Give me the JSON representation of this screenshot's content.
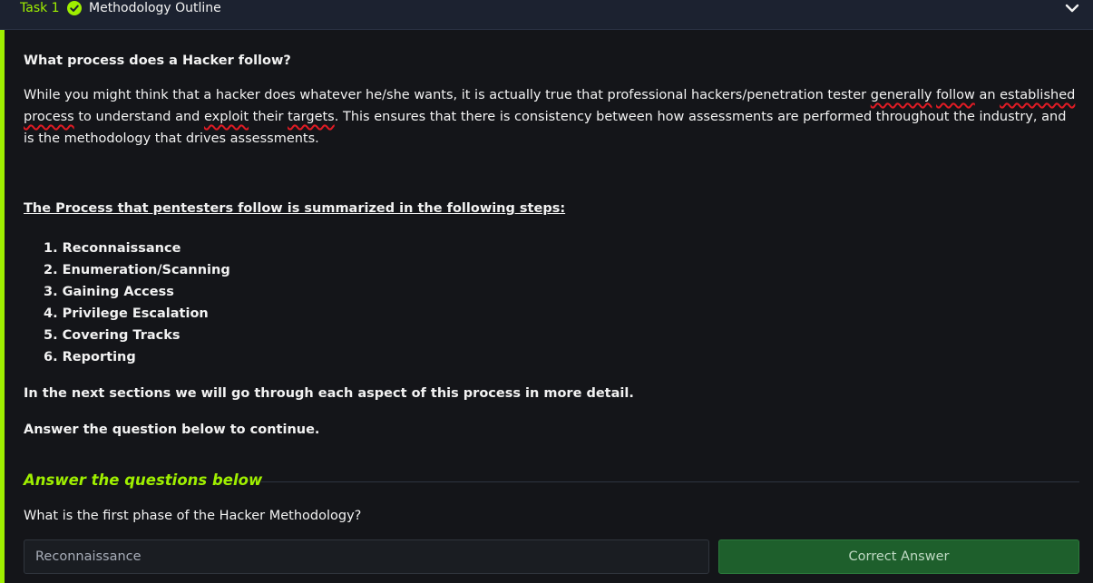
{
  "header": {
    "task_label": "Task 1",
    "title": "Methodology Outline",
    "status_icon": "check-circle-icon",
    "toggle_icon": "chevron-down-icon"
  },
  "colors": {
    "accent": "#9fef00",
    "background": "#141519",
    "header_bg": "#1c2230",
    "success_button": "#1e5f2c",
    "spellcheck": "#e01b24"
  },
  "content": {
    "question_heading": "What process does a Hacker follow?",
    "paragraph": {
      "p1": "While you might think that a hacker does whatever he/she wants, it is actually true that professional hackers/penetration tester ",
      "w1": "generally",
      "s1": " ",
      "w2": "follow",
      "s2": " an ",
      "w3": "established",
      "s3": " ",
      "w4": "process",
      "s4": " to understand and ",
      "w5": "exploit",
      "s5": " their ",
      "w6": "targets",
      "p2": ". This ensures that there is consistency between how assessments are performed throughout the industry, and is the methodology that drives assessments."
    },
    "steps_title": "The Process that pentesters follow is summarized in the following steps:",
    "steps": [
      "1. Reconnaissance",
      "2. Enumeration/Scanning",
      "3. Gaining Access",
      "4. Privilege Escalation",
      "5. Covering Tracks",
      "6. Reporting"
    ],
    "next_sections": "In the next sections we will go through each aspect of this process in more detail.",
    "continue_text": "Answer the question below to continue."
  },
  "answers": {
    "heading": "Answer the questions below",
    "question": "What is the first phase of the Hacker Methodology?",
    "input_value": "Reconnaissance",
    "button_label": "Correct Answer"
  }
}
